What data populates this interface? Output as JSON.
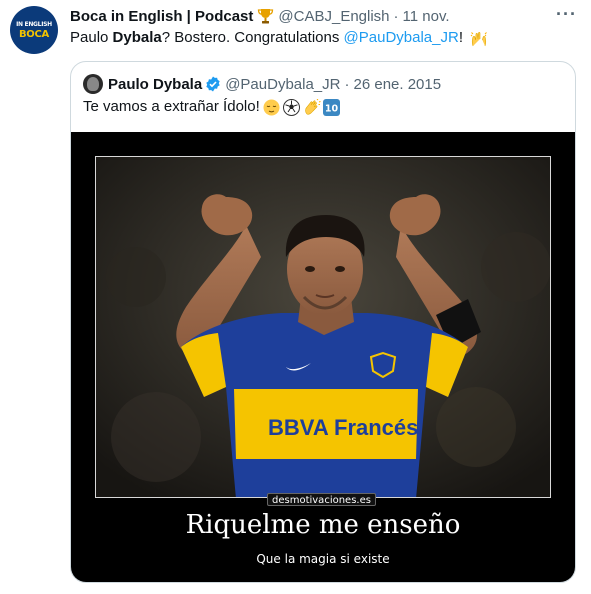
{
  "tweet": {
    "author_name": "Boca in English | Podcast",
    "author_handle": "@CABJ_English",
    "separator": "·",
    "date": "11 nov.",
    "text_part1": "Paulo ",
    "text_bold": "Dybala",
    "text_part2": "? Bostero. Congratulations ",
    "mention": "@PauDybala_JR",
    "text_part3": "! ",
    "more_label": "···",
    "avatar_text_main": "BOCA",
    "avatar_text_small": "IN ENGLISH"
  },
  "quoted": {
    "author_name": "Paulo Dybala",
    "author_handle": "@PauDybala_JR",
    "separator": "·",
    "date": "26 ene. 2015",
    "text": "Te vamos a extrañar Ídolo! ",
    "ten_badge": "10",
    "media": {
      "watermark": "desmotivaciones.es",
      "caption": "Riquelme me enseño",
      "sub_caption": "Que la magia si existe",
      "jersey_sponsor": "BBVA Francés"
    }
  },
  "colors": {
    "link": "#1d9bf0",
    "muted": "#536471",
    "verified": "#1d9bf0",
    "jersey_blue": "#1e3f9b",
    "jersey_yellow": "#f5c400"
  }
}
